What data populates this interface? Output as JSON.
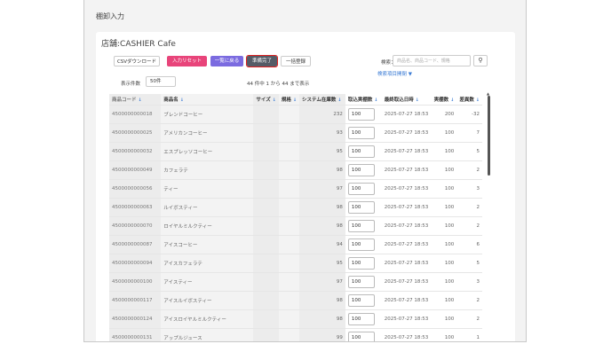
{
  "page_title": "棚卸入力",
  "store_label": "店舗:CASHIER Cafe",
  "toolbar": {
    "csv_label": "CSVダウンロード",
    "reset_label": "入力リセット",
    "back_label": "一覧に戻る",
    "ready_label": "準備完了",
    "bulk_label": "一括登録"
  },
  "search": {
    "label": "検索：",
    "placeholder": "商品名、商品コード、規格",
    "advanced_label": "検索項目開閉"
  },
  "per_page": {
    "label": "表示件数",
    "value": "50件"
  },
  "count_text": "44 件中 1 から 44 まで表示",
  "columns": [
    "商品コード",
    "商品名",
    "サイズ",
    "規格",
    "システム在庫数",
    "取込実棚数",
    "最終取込日時",
    "実棚数",
    "差異数"
  ],
  "rows": [
    {
      "code": "4500000000018",
      "name": "ブレンドコーヒー",
      "size": "",
      "spec": "",
      "system": "232",
      "actual_input": "100",
      "date": "2025-07-27 18:53",
      "real": "200",
      "diff": "-32"
    },
    {
      "code": "4500000000025",
      "name": "アメリカンコーヒー",
      "size": "",
      "spec": "",
      "system": "93",
      "actual_input": "100",
      "date": "2025-07-27 18:53",
      "real": "100",
      "diff": "7"
    },
    {
      "code": "4500000000032",
      "name": "エスプレッソコーヒー",
      "size": "",
      "spec": "",
      "system": "95",
      "actual_input": "100",
      "date": "2025-07-27 18:53",
      "real": "100",
      "diff": "5"
    },
    {
      "code": "4500000000049",
      "name": "カフェラテ",
      "size": "",
      "spec": "",
      "system": "98",
      "actual_input": "100",
      "date": "2025-07-27 18:53",
      "real": "100",
      "diff": "2"
    },
    {
      "code": "4500000000056",
      "name": "ティー",
      "size": "",
      "spec": "",
      "system": "97",
      "actual_input": "100",
      "date": "2025-07-27 18:53",
      "real": "100",
      "diff": "3"
    },
    {
      "code": "4500000000063",
      "name": "ルイボスティー",
      "size": "",
      "spec": "",
      "system": "98",
      "actual_input": "100",
      "date": "2025-07-27 18:53",
      "real": "100",
      "diff": "2"
    },
    {
      "code": "4500000000070",
      "name": "ロイヤルミルクティー",
      "size": "",
      "spec": "",
      "system": "98",
      "actual_input": "100",
      "date": "2025-07-27 18:53",
      "real": "100",
      "diff": "2"
    },
    {
      "code": "4500000000087",
      "name": "アイスコーヒー",
      "size": "",
      "spec": "",
      "system": "94",
      "actual_input": "100",
      "date": "2025-07-27 18:53",
      "real": "100",
      "diff": "6"
    },
    {
      "code": "4500000000094",
      "name": "アイスカフェラテ",
      "size": "",
      "spec": "",
      "system": "95",
      "actual_input": "100",
      "date": "2025-07-27 18:53",
      "real": "100",
      "diff": "5"
    },
    {
      "code": "4500000000100",
      "name": "アイスティー",
      "size": "",
      "spec": "",
      "system": "97",
      "actual_input": "100",
      "date": "2025-07-27 18:53",
      "real": "100",
      "diff": "3"
    },
    {
      "code": "4500000000117",
      "name": "アイスルイボスティー",
      "size": "",
      "spec": "",
      "system": "98",
      "actual_input": "100",
      "date": "2025-07-27 18:53",
      "real": "100",
      "diff": "2"
    },
    {
      "code": "4500000000124",
      "name": "アイスロイヤルミルクティー",
      "size": "",
      "spec": "",
      "system": "98",
      "actual_input": "100",
      "date": "2025-07-27 18:53",
      "real": "100",
      "diff": "2"
    },
    {
      "code": "4500000000131",
      "name": "アップルジュース",
      "size": "",
      "spec": "",
      "system": "99",
      "actual_input": "100",
      "date": "2025-07-27 18:53",
      "real": "100",
      "diff": "1"
    }
  ]
}
